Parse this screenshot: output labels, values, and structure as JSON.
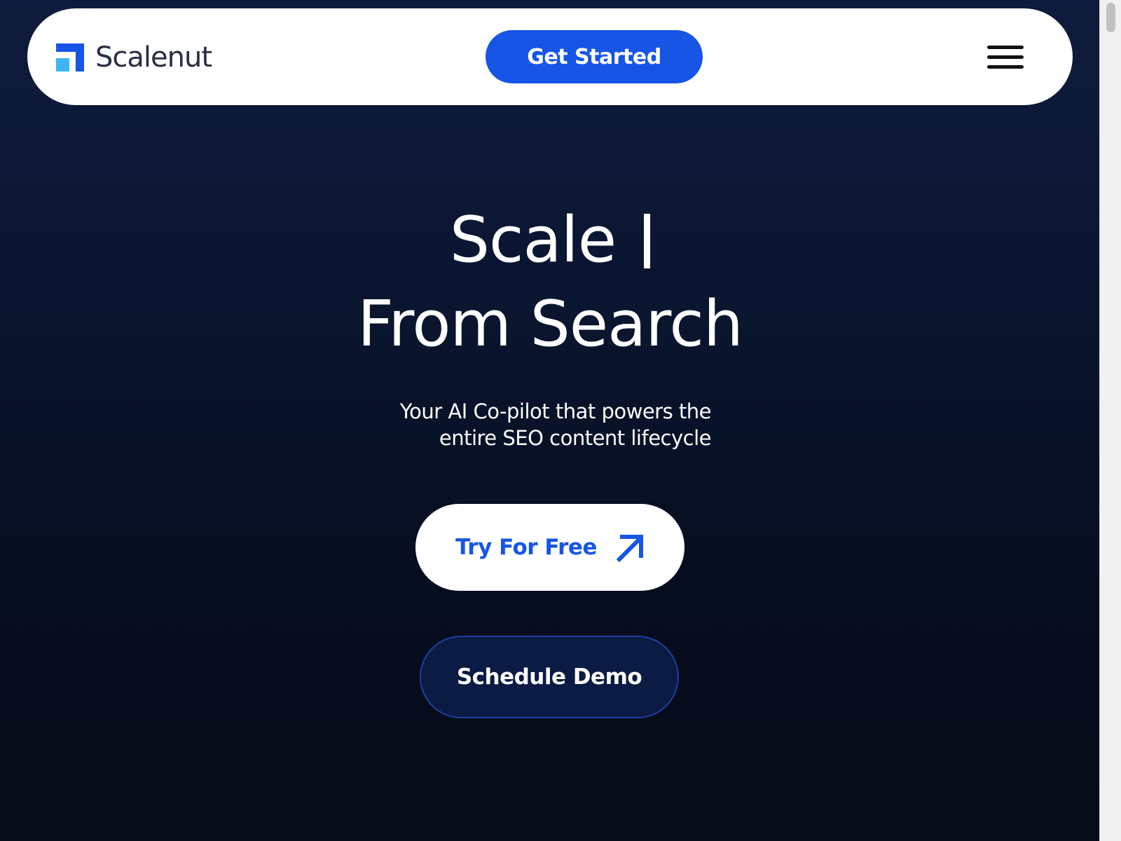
{
  "header": {
    "logo_text": "Scalenut",
    "cta_label": "Get Started",
    "menu_icon": "hamburger-menu-icon"
  },
  "hero": {
    "title_line1": "Scale",
    "title_line2": "From Search",
    "subtitle_line1": "Your AI Co-pilot that powers the",
    "subtitle_line2": "entire SEO content lifecycle",
    "primary_cta": "Try For Free",
    "primary_cta_icon": "arrow-up-right-icon",
    "secondary_cta": "Schedule Demo"
  },
  "colors": {
    "brand_blue": "#1655e5",
    "logo_light_blue": "#3db5f2",
    "background_dark": "#0a1630",
    "demo_button_bg": "#0b1b44"
  }
}
